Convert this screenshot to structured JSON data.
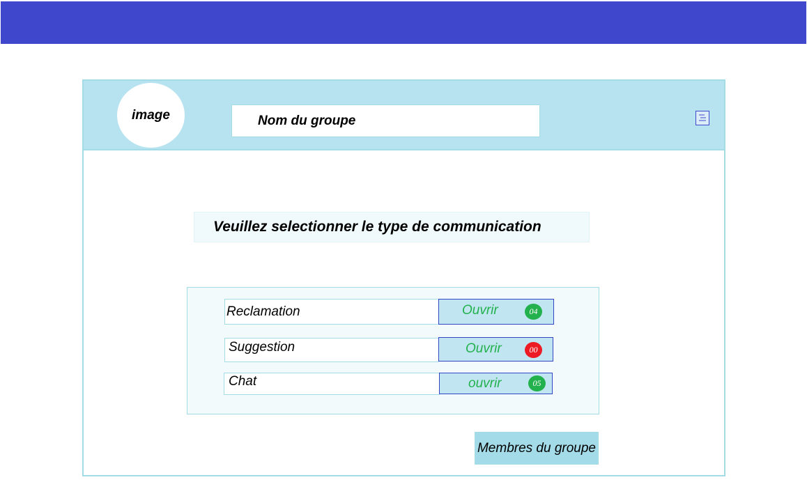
{
  "header": {
    "avatar_text": "image",
    "group_name": "Nom du groupe",
    "menu_icon": "menu-icon"
  },
  "prompt": "Veuillez selectionner le type de communication",
  "communication_types": [
    {
      "label": "Reclamation",
      "button": "Ouvrir",
      "count": "04",
      "badge_color": "#22b14c"
    },
    {
      "label": "Suggestion",
      "button": "Ouvrir",
      "count": "00",
      "badge_color": "#ed1c24"
    },
    {
      "label": "Chat",
      "button": "ouvrir",
      "count": "05",
      "badge_color": "#22b14c"
    }
  ],
  "members_button": "Membres du groupe",
  "colors": {
    "topbar": "#3f48cc",
    "header": "#b7e3f0",
    "border": "#a3dbe6",
    "button_text": "#22b14c",
    "button_border": "#2f45c4"
  }
}
